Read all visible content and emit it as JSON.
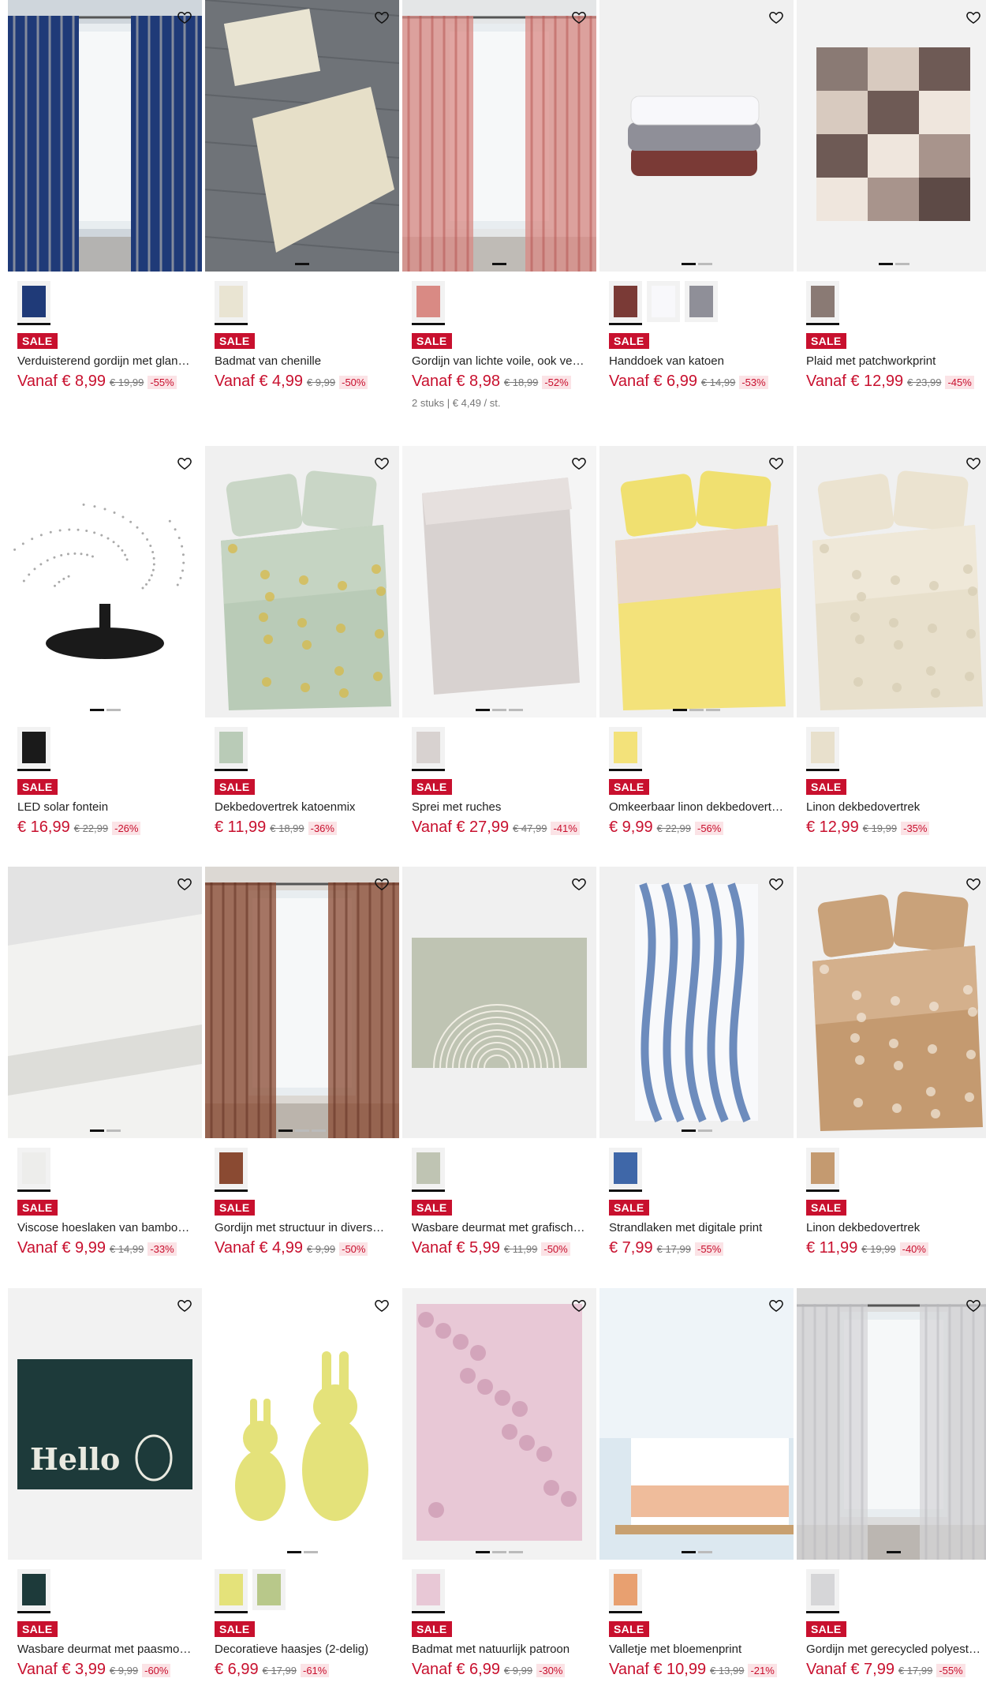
{
  "ui": {
    "sale_label": "SALE"
  },
  "products": [
    {
      "title": "Verduisterend gordijn met glanze…",
      "price": "Vanaf € 8,99",
      "old_price": "€ 19,99",
      "discount": "-55%",
      "image": "navy-curtain",
      "swatches": 1,
      "dots": 0,
      "active_dot": 0
    },
    {
      "title": "Badmat van chenille",
      "price": "Vanaf € 4,99",
      "old_price": "€ 9,99",
      "discount": "-50%",
      "image": "bathmat",
      "swatches": 1,
      "dots": 1,
      "active_dot": 0
    },
    {
      "title": "Gordijn van lichte voile, ook verk…",
      "price": "Vanaf € 8,98",
      "old_price": "€ 18,99",
      "discount": "-52%",
      "extra": "2 stuks | € 4,49 / st.",
      "image": "voile-curtain",
      "swatches": 1,
      "dots": 1,
      "active_dot": 0
    },
    {
      "title": "Handdoek van katoen",
      "price": "Vanaf € 6,99",
      "old_price": "€ 14,99",
      "discount": "-53%",
      "image": "towels",
      "swatches": 3,
      "dots": 2,
      "active_dot": 0
    },
    {
      "title": "Plaid met patchworkprint",
      "price": "Vanaf € 12,99",
      "old_price": "€ 23,99",
      "discount": "-45%",
      "image": "patchwork",
      "swatches": 1,
      "dots": 2,
      "active_dot": 0
    },
    {
      "title": "LED solar fontein",
      "price": "€ 16,99",
      "old_price": "€ 22,99",
      "discount": "-26%",
      "image": "fountain",
      "swatches": 1,
      "dots": 2,
      "active_dot": 0
    },
    {
      "title": "Dekbedovertrek katoenmix",
      "price": "€ 11,99",
      "old_price": "€ 18,99",
      "discount": "-36%",
      "image": "green-bed",
      "swatches": 1,
      "dots": 0,
      "active_dot": 0
    },
    {
      "title": "Sprei met ruches",
      "price": "Vanaf € 27,99",
      "old_price": "€ 47,99",
      "discount": "-41%",
      "image": "ruffle-throw",
      "swatches": 1,
      "dots": 3,
      "active_dot": 0
    },
    {
      "title": "Omkeerbaar linon dekbedovertrek",
      "price": "€ 9,99",
      "old_price": "€ 22,99",
      "discount": "-56%",
      "image": "yellow-bed",
      "swatches": 1,
      "dots": 3,
      "active_dot": 0
    },
    {
      "title": "Linon dekbedovertrek",
      "price": "€ 12,99",
      "old_price": "€ 19,99",
      "discount": "-35%",
      "image": "beige-bed",
      "swatches": 1,
      "dots": 0,
      "active_dot": 0
    },
    {
      "title": "Viscose hoeslaken van bamboece…",
      "price": "Vanaf € 9,99",
      "old_price": "€ 14,99",
      "discount": "-33%",
      "image": "fitted-sheet",
      "swatches": 1,
      "dots": 2,
      "active_dot": 0
    },
    {
      "title": "Gordijn met structuur in diverse …",
      "price": "Vanaf € 4,99",
      "old_price": "€ 9,99",
      "discount": "-50%",
      "image": "brown-curtain",
      "swatches": 1,
      "dots": 3,
      "active_dot": 0
    },
    {
      "title": "Wasbare deurmat met grafisch d…",
      "price": "Vanaf € 5,99",
      "old_price": "€ 11,99",
      "discount": "-50%",
      "image": "arc-mat",
      "swatches": 1,
      "dots": 0,
      "active_dot": 0
    },
    {
      "title": "Strandlaken met digitale print",
      "price": "€ 7,99",
      "old_price": "€ 17,99",
      "discount": "-55%",
      "image": "beach-towel",
      "swatches": 1,
      "dots": 2,
      "active_dot": 0
    },
    {
      "title": "Linon dekbedovertrek",
      "price": "€ 11,99",
      "old_price": "€ 19,99",
      "discount": "-40%",
      "image": "floral-bed",
      "swatches": 1,
      "dots": 0,
      "active_dot": 0
    },
    {
      "title": "Wasbare deurmat met paasmotief",
      "price": "Vanaf € 3,99",
      "old_price": "€ 9,99",
      "discount": "-60%",
      "image": "hello-mat",
      "image_text": "Hello",
      "swatches": 1,
      "dots": 0,
      "active_dot": 0
    },
    {
      "title": "Decoratieve haasjes (2-delig)",
      "price": "€ 6,99",
      "old_price": "€ 17,99",
      "discount": "-61%",
      "image": "bunnies",
      "swatches": 2,
      "dots": 2,
      "active_dot": 0
    },
    {
      "title": "Badmat met natuurlijk patroon",
      "price": "Vanaf € 6,99",
      "old_price": "€ 9,99",
      "discount": "-30%",
      "image": "pink-mat",
      "swatches": 1,
      "dots": 3,
      "active_dot": 0
    },
    {
      "title": "Valletje met bloemenprint",
      "price": "Vanaf € 10,99",
      "old_price": "€ 13,99",
      "discount": "-21%",
      "image": "cafe-curtain",
      "swatches": 1,
      "dots": 2,
      "active_dot": 0
    },
    {
      "title": "Gordijn met gerecycled polyester…",
      "price": "Vanaf € 7,99",
      "old_price": "€ 17,99",
      "discount": "-55%",
      "image": "leaf-curtain",
      "swatches": 1,
      "dots": 1,
      "active_dot": 0
    }
  ]
}
